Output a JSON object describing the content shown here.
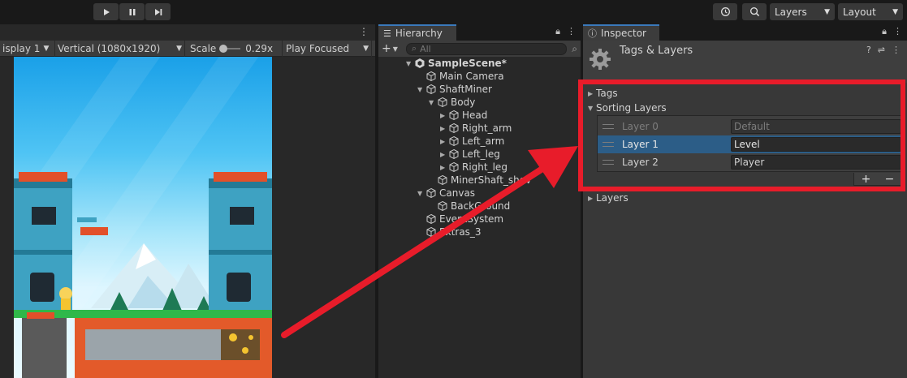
{
  "toolbar": {
    "layers_label": "Layers",
    "layout_label": "Layout"
  },
  "game_view": {
    "display": "isplay 1",
    "resolution": "Vertical (1080x1920)",
    "scale_label": "Scale",
    "scale_value": "0.29x",
    "play_mode": "Play Focused"
  },
  "hierarchy": {
    "tab_label": "Hierarchy",
    "search_placeholder": "All",
    "items": [
      {
        "label": "SampleScene*"
      },
      {
        "label": "Main Camera"
      },
      {
        "label": "ShaftMiner"
      },
      {
        "label": "Body"
      },
      {
        "label": "Head"
      },
      {
        "label": "Right_arm"
      },
      {
        "label": "Left_arm"
      },
      {
        "label": "Left_leg"
      },
      {
        "label": "Right_leg"
      },
      {
        "label": "MinerShaft_shov"
      },
      {
        "label": "Canvas"
      },
      {
        "label": "BackGround"
      },
      {
        "label": "EventSystem"
      },
      {
        "label": "Extras_3"
      }
    ]
  },
  "inspector": {
    "tab_label": "Inspector",
    "title": "Tags & Layers",
    "sections": {
      "tags": "Tags",
      "sorting_layers": "Sorting Layers",
      "layers": "Layers"
    },
    "sorting_layers": [
      {
        "name": "Layer 0",
        "value": "Default"
      },
      {
        "name": "Layer 1",
        "value": "Level"
      },
      {
        "name": "Layer 2",
        "value": "Player"
      }
    ],
    "add_label": "+",
    "remove_label": "−"
  },
  "colors": {
    "highlight": "#e81c2a",
    "selection": "#2c5d87",
    "panel": "#383838"
  }
}
